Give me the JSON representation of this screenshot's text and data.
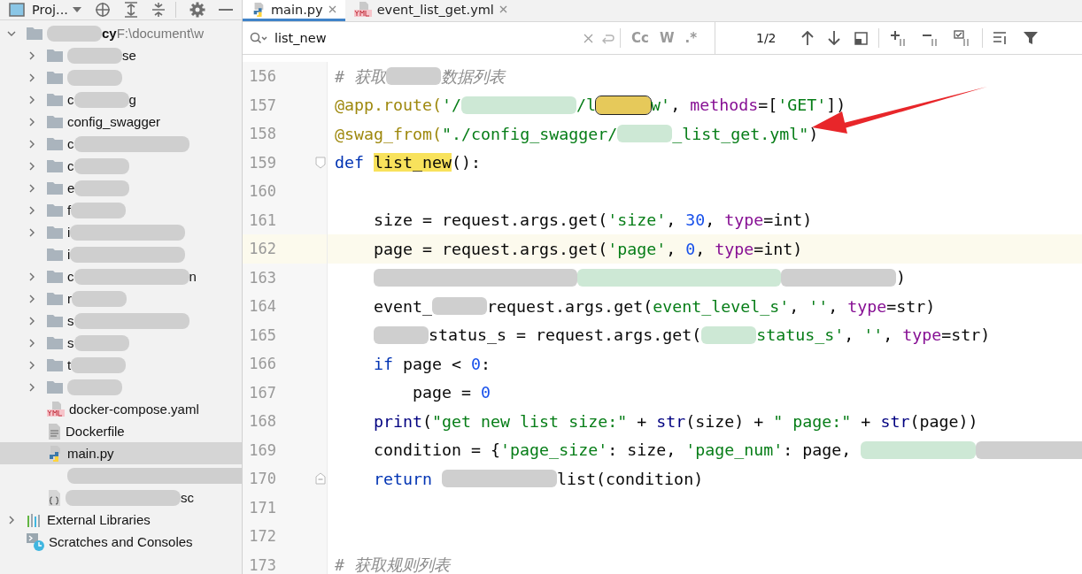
{
  "project_toolbar": {
    "title": "Proj..."
  },
  "tree": [
    {
      "kind": "project",
      "expanded": true,
      "selected": false,
      "parts": [
        {
          "kind": "blur-s"
        },
        {
          "kind": "bold",
          "text": "cy"
        },
        {
          "kind": "path",
          "text": " F:\\document\\w"
        }
      ],
      "children": [
        {
          "kind": "folder",
          "expanded": false,
          "selected": false,
          "parts": [
            {
              "kind": "blur-s"
            },
            {
              "kind": "text",
              "text": "se"
            }
          ]
        },
        {
          "kind": "folder",
          "expanded": false,
          "selected": false,
          "parts": [
            {
              "kind": "blur-s"
            }
          ]
        },
        {
          "kind": "folder",
          "expanded": false,
          "selected": false,
          "parts": [
            {
              "kind": "text",
              "text": "c"
            },
            {
              "kind": "blur-s"
            },
            {
              "kind": "text",
              "text": "g"
            }
          ]
        },
        {
          "kind": "folder",
          "expanded": false,
          "selected": false,
          "parts": [
            {
              "kind": "text",
              "text": "config_swagger"
            }
          ]
        },
        {
          "kind": "folder",
          "expanded": false,
          "selected": false,
          "parts": [
            {
              "kind": "text",
              "text": "c"
            },
            {
              "kind": "blur-m"
            }
          ]
        },
        {
          "kind": "folder",
          "expanded": false,
          "selected": false,
          "parts": [
            {
              "kind": "text",
              "text": "c"
            },
            {
              "kind": "blur-s"
            }
          ]
        },
        {
          "kind": "folder",
          "expanded": false,
          "selected": false,
          "parts": [
            {
              "kind": "text",
              "text": "e"
            },
            {
              "kind": "blur-s"
            }
          ]
        },
        {
          "kind": "folder",
          "expanded": false,
          "selected": false,
          "parts": [
            {
              "kind": "text",
              "text": "f"
            },
            {
              "kind": "blur-s"
            }
          ]
        },
        {
          "kind": "folder",
          "expanded": false,
          "selected": false,
          "parts": [
            {
              "kind": "text",
              "text": "i"
            },
            {
              "kind": "blur-m"
            }
          ]
        },
        {
          "kind": "empty-folder",
          "selected": false,
          "parts": [
            {
              "kind": "text",
              "text": "i"
            },
            {
              "kind": "blur-m"
            }
          ]
        },
        {
          "kind": "folder",
          "expanded": false,
          "selected": false,
          "parts": [
            {
              "kind": "text",
              "text": "c"
            },
            {
              "kind": "blur-m"
            },
            {
              "kind": "text",
              "text": "n"
            }
          ]
        },
        {
          "kind": "folder",
          "expanded": false,
          "selected": false,
          "parts": [
            {
              "kind": "text",
              "text": "r"
            },
            {
              "kind": "blur-s"
            }
          ]
        },
        {
          "kind": "folder",
          "expanded": false,
          "selected": false,
          "parts": [
            {
              "kind": "text",
              "text": "s"
            },
            {
              "kind": "blur-m"
            }
          ]
        },
        {
          "kind": "folder",
          "expanded": false,
          "selected": false,
          "parts": [
            {
              "kind": "text",
              "text": "s"
            },
            {
              "kind": "blur-s"
            }
          ]
        },
        {
          "kind": "folder",
          "expanded": false,
          "selected": false,
          "parts": [
            {
              "kind": "text",
              "text": "t"
            },
            {
              "kind": "blur-s"
            }
          ]
        },
        {
          "kind": "folder",
          "expanded": false,
          "selected": false,
          "parts": [
            {
              "kind": "blur-s"
            }
          ]
        },
        {
          "kind": "yaml",
          "selected": false,
          "parts": [
            {
              "kind": "text",
              "text": "docker-compose.yaml"
            }
          ]
        },
        {
          "kind": "text-file",
          "selected": false,
          "parts": [
            {
              "kind": "text",
              "text": "Dockerfile"
            }
          ]
        },
        {
          "kind": "python",
          "selected": true,
          "parts": [
            {
              "kind": "text",
              "text": "main.py"
            }
          ]
        },
        {
          "kind": "hidden",
          "selected": false,
          "parts": [
            {
              "kind": "blur-l"
            }
          ]
        },
        {
          "kind": "json",
          "selected": false,
          "parts": [
            {
              "kind": "blur-m"
            },
            {
              "kind": "text",
              "text": "sc"
            }
          ]
        }
      ]
    },
    {
      "kind": "libraries",
      "expanded": false,
      "selected": false,
      "parts": [
        {
          "kind": "text",
          "text": "External Libraries"
        }
      ]
    },
    {
      "kind": "scratches",
      "selected": false,
      "parts": [
        {
          "kind": "text",
          "text": "Scratches and Consoles"
        }
      ]
    }
  ],
  "tabs": [
    {
      "label": "main.py",
      "kind": "python",
      "selected": true
    },
    {
      "label": "event_list_get.yml",
      "kind": "yaml",
      "selected": false
    }
  ],
  "search": {
    "value": "list_new",
    "case_label": "Cc",
    "word_label": "W",
    "regex_label": ".*",
    "count": "1/2"
  },
  "lines": [
    {
      "number": "156",
      "current": false,
      "tokens": [
        {
          "kind": "comment",
          "text": "# 获取"
        },
        {
          "kind": "blur-s"
        },
        {
          "kind": "comment",
          "text": "数据列表"
        }
      ]
    },
    {
      "number": "157",
      "current": false,
      "tokens": [
        {
          "kind": "deco",
          "text": "@app.route("
        },
        {
          "kind": "str",
          "text": "'/"
        },
        {
          "kind": "green-m"
        },
        {
          "kind": "str",
          "text": "/l"
        },
        {
          "kind": "yellow-s"
        },
        {
          "kind": "str",
          "text": "w'"
        },
        {
          "kind": "plain",
          "text": ", "
        },
        {
          "kind": "param",
          "text": "methods"
        },
        {
          "kind": "plain",
          "text": "=["
        },
        {
          "kind": "str",
          "text": "'GET'"
        },
        {
          "kind": "plain",
          "text": "])"
        }
      ]
    },
    {
      "number": "158",
      "current": false,
      "tokens": [
        {
          "kind": "deco",
          "text": "@swag_from("
        },
        {
          "kind": "str",
          "text": "\"./config_swagger/"
        },
        {
          "kind": "green-s"
        },
        {
          "kind": "str",
          "text": "_list_get.yml\""
        },
        {
          "kind": "plain",
          "text": ")"
        }
      ]
    },
    {
      "number": "159",
      "current": false,
      "expanded": true,
      "tokens": [
        {
          "kind": "kw",
          "text": "def "
        },
        {
          "kind": "match",
          "text": "list_new"
        },
        {
          "kind": "plain",
          "text": "():"
        }
      ],
      "children": [
        {
          "number": "160",
          "current": false
        },
        {
          "number": "161",
          "current": false,
          "tokens": [
            {
              "kind": "plain",
              "text": "size = request.args.get("
            },
            {
              "kind": "str",
              "text": "'size'"
            },
            {
              "kind": "plain",
              "text": ", "
            },
            {
              "kind": "num",
              "text": "30"
            },
            {
              "kind": "plain",
              "text": ", "
            },
            {
              "kind": "param",
              "text": "type"
            },
            {
              "kind": "plain",
              "text": "=int)"
            }
          ]
        },
        {
          "number": "162",
          "current": true,
          "tokens": [
            {
              "kind": "plain",
              "text": "page = request.args.get("
            },
            {
              "kind": "str",
              "text": "'page'"
            },
            {
              "kind": "plain",
              "text": ", "
            },
            {
              "kind": "num",
              "text": "0"
            },
            {
              "kind": "plain",
              "text": ", "
            },
            {
              "kind": "param",
              "text": "type"
            },
            {
              "kind": "plain",
              "text": "=int)"
            }
          ]
        },
        {
          "number": "163",
          "current": false,
          "tokens": [
            {
              "kind": "blur-l"
            },
            {
              "kind": "green-l"
            },
            {
              "kind": "blur-m"
            },
            {
              "kind": "plain",
              "text": ")"
            }
          ]
        },
        {
          "number": "164",
          "current": false,
          "tokens": [
            {
              "kind": "plain",
              "text": "event_"
            },
            {
              "kind": "blur-s"
            },
            {
              "kind": "plain",
              "text": "request.args.get("
            },
            {
              "kind": "str",
              "text": "event_level_s'"
            },
            {
              "kind": "plain",
              "text": ", "
            },
            {
              "kind": "str",
              "text": "''"
            },
            {
              "kind": "plain",
              "text": ", "
            },
            {
              "kind": "param",
              "text": "type"
            },
            {
              "kind": "plain",
              "text": "=str)"
            }
          ]
        },
        {
          "number": "165",
          "current": false,
          "tokens": [
            {
              "kind": "blur-s"
            },
            {
              "kind": "plain",
              "text": "status_s = request.args.get("
            },
            {
              "kind": "green-s"
            },
            {
              "kind": "str",
              "text": "status_s'"
            },
            {
              "kind": "plain",
              "text": ", "
            },
            {
              "kind": "str",
              "text": "''"
            },
            {
              "kind": "plain",
              "text": ", "
            },
            {
              "kind": "param",
              "text": "type"
            },
            {
              "kind": "plain",
              "text": "=str)"
            }
          ]
        },
        {
          "number": "166",
          "current": false,
          "tokens": [
            {
              "kind": "kw",
              "text": "if "
            },
            {
              "kind": "plain",
              "text": "page < "
            },
            {
              "kind": "num",
              "text": "0"
            },
            {
              "kind": "plain",
              "text": ":"
            }
          ],
          "children": [
            {
              "number": "167",
              "current": false,
              "tokens": [
                {
                  "kind": "plain",
                  "text": "page = "
                },
                {
                  "kind": "num",
                  "text": "0"
                }
              ]
            }
          ]
        },
        {
          "number": "168",
          "current": false,
          "tokens": [
            {
              "kind": "builtin",
              "text": "print"
            },
            {
              "kind": "plain",
              "text": "("
            },
            {
              "kind": "str",
              "text": "\"get new list size:\""
            },
            {
              "kind": "plain",
              "text": " + "
            },
            {
              "kind": "builtin",
              "text": "str"
            },
            {
              "kind": "plain",
              "text": "(size) + "
            },
            {
              "kind": "str",
              "text": "\" page:\""
            },
            {
              "kind": "plain",
              "text": " + "
            },
            {
              "kind": "builtin",
              "text": "str"
            },
            {
              "kind": "plain",
              "text": "(page))"
            }
          ]
        },
        {
          "number": "169",
          "current": false,
          "tokens": [
            {
              "kind": "plain",
              "text": "condition = {"
            },
            {
              "kind": "str",
              "text": "'page_size'"
            },
            {
              "kind": "plain",
              "text": ": size, "
            },
            {
              "kind": "str",
              "text": "'page_num'"
            },
            {
              "kind": "plain",
              "text": ": page, "
            },
            {
              "kind": "green-m"
            },
            {
              "kind": "blur-m"
            }
          ]
        },
        {
          "number": "170",
          "current": false,
          "tokens": [
            {
              "kind": "kw",
              "text": "return "
            },
            {
              "kind": "blur-m"
            },
            {
              "kind": "plain",
              "text": "list(condition)"
            }
          ]
        }
      ]
    },
    {
      "number": "171",
      "current": false
    },
    {
      "number": "172",
      "current": false
    },
    {
      "number": "173",
      "current": false,
      "tokens": [
        {
          "kind": "comment",
          "text": "# 获取规则列表"
        }
      ]
    }
  ]
}
